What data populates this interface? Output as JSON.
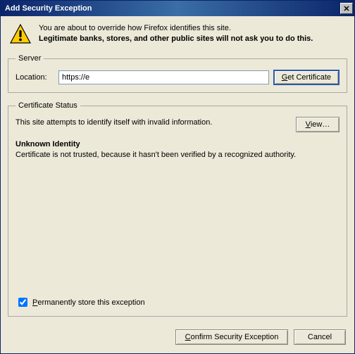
{
  "titlebar": {
    "title": "Add Security Exception"
  },
  "intro": {
    "line1": "You are about to override how Firefox identifies this site.",
    "line2": "Legitimate banks, stores, and other public sites will not ask you to do this."
  },
  "server": {
    "legend": "Server",
    "location_label": "Location:",
    "location_value": "https://e",
    "get_cert_label": "Get Certificate"
  },
  "cert": {
    "legend": "Certificate Status",
    "msg": "This site attempts to identify itself with invalid information.",
    "view_label": "View…",
    "heading": "Unknown Identity",
    "desc": "Certificate is not trusted, because it hasn't been verified by a recognized authority.",
    "perm_label": "Permanently store this exception"
  },
  "footer": {
    "confirm": "Confirm Security Exception",
    "cancel": "Cancel"
  }
}
